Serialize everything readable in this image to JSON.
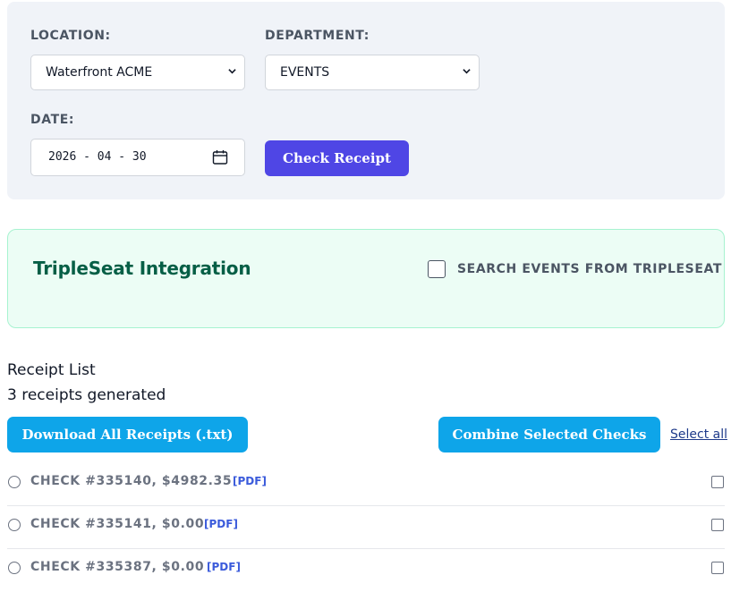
{
  "filters": {
    "location_label": "LOCATION:",
    "location_value": "Waterfront ACME",
    "department_label": "DEPARTMENT:",
    "department_value": "EVENTS",
    "date_label": "DATE:",
    "date_value": "2026 - 04 - 30",
    "check_button": "Check Receipt"
  },
  "tripleseat": {
    "title": "TripleSeat Integration",
    "search_label": "SEARCH EVENTS FROM TRIPLESEAT",
    "search_checked": false
  },
  "receipts": {
    "section_title": "Receipt List",
    "count_text": "3 receipts generated",
    "download_button": "Download All Receipts (.txt)",
    "combine_button": "Combine Selected Checks",
    "select_all": "Select all",
    "items": [
      {
        "label": "CHECK #335140, $4982.35",
        "pdf": "[PDF]"
      },
      {
        "label": "CHECK #335141, $0.00",
        "pdf": "[PDF]"
      },
      {
        "label": "CHECK #335387, $0.00",
        "pdf": "[PDF]"
      }
    ]
  },
  "colors": {
    "primary": "#4f46e5",
    "accent": "#0ea5e9",
    "tripleseat_bg": "#ecfdf5",
    "tripleseat_title": "#065f46"
  }
}
